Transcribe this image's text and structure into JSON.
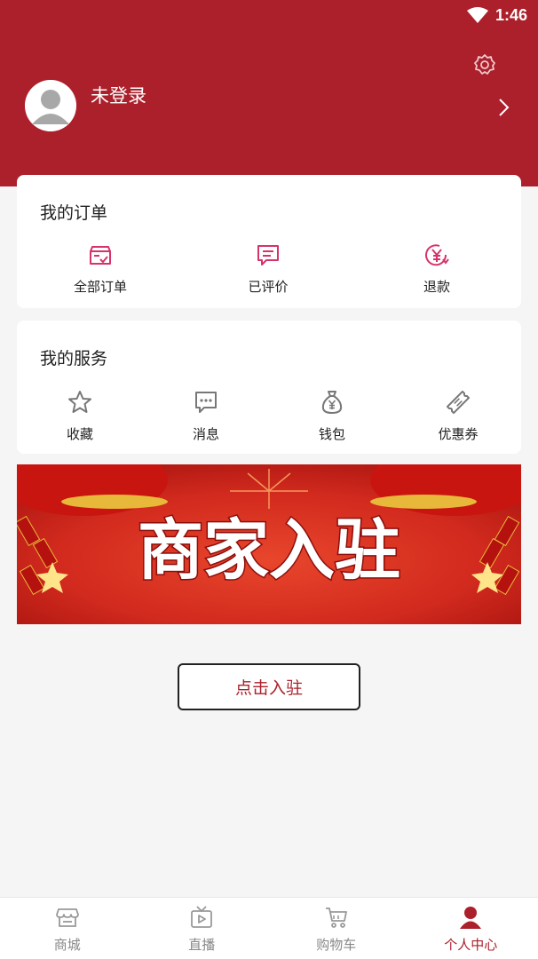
{
  "status_bar": {
    "time": "1:46"
  },
  "profile": {
    "login_text": "未登录"
  },
  "orders": {
    "title": "我的订单",
    "items": [
      {
        "label": "全部订单",
        "icon": "order-box-icon"
      },
      {
        "label": "已评价",
        "icon": "comment-icon"
      },
      {
        "label": "退款",
        "icon": "refund-yen-icon"
      }
    ]
  },
  "services": {
    "title": "我的服务",
    "items": [
      {
        "label": "收藏",
        "icon": "star-icon"
      },
      {
        "label": "消息",
        "icon": "message-icon"
      },
      {
        "label": "钱包",
        "icon": "money-bag-icon"
      },
      {
        "label": "优惠券",
        "icon": "coupon-icon"
      }
    ]
  },
  "banner": {
    "text": "商家入驻"
  },
  "join_button": {
    "label": "点击入驻"
  },
  "tabbar": {
    "items": [
      {
        "label": "商城",
        "icon": "store-icon"
      },
      {
        "label": "直播",
        "icon": "tv-icon"
      },
      {
        "label": "购物车",
        "icon": "cart-icon"
      },
      {
        "label": "个人中心",
        "icon": "user-icon",
        "active": true
      }
    ]
  },
  "colors": {
    "brand": "#ab202b",
    "accent_icon": "#d6336c",
    "background": "#f5f5f5"
  }
}
